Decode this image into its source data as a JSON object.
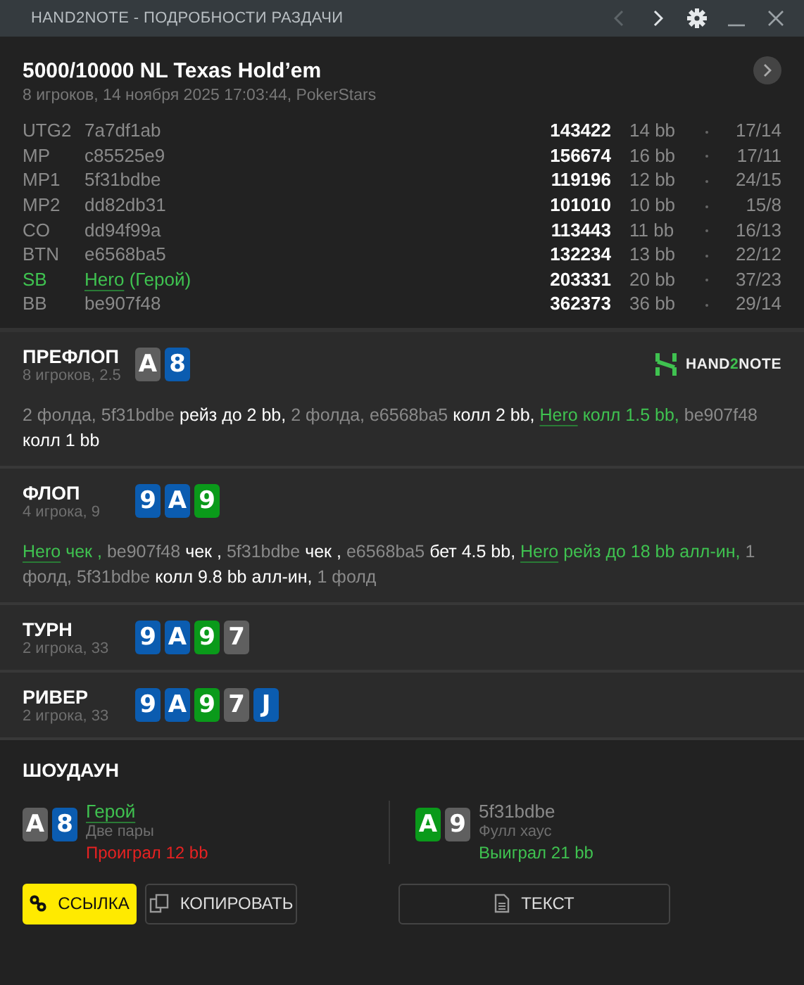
{
  "window": {
    "title": "HAND2NOTE - ПОДРОБНОСТИ РАЗДАЧИ",
    "back_enabled": false,
    "forward_enabled": true
  },
  "header": {
    "title": "5000/10000 NL Texas Hold’em",
    "subtitle": "8 игроков, 14 ноября 2025 17:03:44, PokerStars"
  },
  "players": [
    {
      "position": "UTG2",
      "name": "7a7df1ab",
      "hero": false,
      "stack": "143422",
      "bb": "14 bb",
      "stats": "17/14"
    },
    {
      "position": "MP",
      "name": "c85525e9",
      "hero": false,
      "stack": "156674",
      "bb": "16 bb",
      "stats": "17/11"
    },
    {
      "position": "MP1",
      "name": "5f31bdbe",
      "hero": false,
      "stack": "119196",
      "bb": "12 bb",
      "stats": "24/15"
    },
    {
      "position": "MP2",
      "name": "dd82db31",
      "hero": false,
      "stack": "101010",
      "bb": "10 bb",
      "stats": "15/8"
    },
    {
      "position": "CO",
      "name": "dd94f99a",
      "hero": false,
      "stack": "113443",
      "bb": "11 bb",
      "stats": "16/13"
    },
    {
      "position": "BTN",
      "name": "e6568ba5",
      "hero": false,
      "stack": "132234",
      "bb": "13 bb",
      "stats": "22/12"
    },
    {
      "position": "SB",
      "name": "Hero",
      "note": "(Герой)",
      "hero": true,
      "stack": "203331",
      "bb": "20 bb",
      "stats": "37/23"
    },
    {
      "position": "BB",
      "name": "be907f48",
      "hero": false,
      "stack": "362373",
      "bb": "36 bb",
      "stats": "29/14"
    }
  ],
  "logo": {
    "before": "HAND",
    "accent": "2",
    "after": "NOTE"
  },
  "streets": [
    {
      "name": "ПРЕФЛОП",
      "subtitle": "8 игроков, 2.5",
      "cards": [
        {
          "rank": "A",
          "color": "#5f5f5f"
        },
        {
          "rank": "8",
          "color": "#0b5cb0"
        }
      ],
      "actions": [
        {
          "kind": "plain",
          "text": "2 фолда, 5f31bdbe"
        },
        {
          "kind": "action",
          "text": "рейз до 2 bb,"
        },
        {
          "kind": "plain",
          "text": "2 фолда, e6568ba5"
        },
        {
          "kind": "action",
          "text": "колл 2 bb,"
        },
        {
          "kind": "hero",
          "text": "Hero"
        },
        {
          "kind": "hero_action",
          "text": "колл 1.5 bb,"
        },
        {
          "kind": "plain",
          "text": "be907f48"
        },
        {
          "kind": "action",
          "text": "колл 1 bb"
        }
      ]
    },
    {
      "name": "ФЛОП",
      "subtitle": "4 игрока, 9",
      "cards": [
        {
          "rank": "9",
          "color": "#0b5cb0"
        },
        {
          "rank": "A",
          "color": "#0b5cb0"
        },
        {
          "rank": "9",
          "color": "#0a9a1a"
        }
      ],
      "actions": [
        {
          "kind": "hero",
          "text": "Hero"
        },
        {
          "kind": "hero_action",
          "text": "чек ,"
        },
        {
          "kind": "plain",
          "text": "be907f48"
        },
        {
          "kind": "action",
          "text": "чек ,"
        },
        {
          "kind": "plain",
          "text": "5f31bdbe"
        },
        {
          "kind": "action",
          "text": "чек ,"
        },
        {
          "kind": "plain",
          "text": "e6568ba5"
        },
        {
          "kind": "action",
          "text": "бет 4.5 bb,"
        },
        {
          "kind": "hero",
          "text": "Hero"
        },
        {
          "kind": "hero_action",
          "text": "рейз до 18 bb алл-ин,"
        },
        {
          "kind": "plain",
          "text": "1 фолд, 5f31bdbe"
        },
        {
          "kind": "action",
          "text": "колл 9.8 bb алл-ин,"
        },
        {
          "kind": "plain",
          "text": "1 фолд"
        }
      ]
    },
    {
      "name": "ТУРН",
      "subtitle": "2 игрока, 33",
      "cards": [
        {
          "rank": "9",
          "color": "#0b5cb0"
        },
        {
          "rank": "A",
          "color": "#0b5cb0"
        },
        {
          "rank": "9",
          "color": "#0a9a1a"
        },
        {
          "rank": "7",
          "color": "#5f5f5f"
        }
      ]
    },
    {
      "name": "РИВЕР",
      "subtitle": "2 игрока, 33",
      "cards": [
        {
          "rank": "9",
          "color": "#0b5cb0"
        },
        {
          "rank": "A",
          "color": "#0b5cb0"
        },
        {
          "rank": "9",
          "color": "#0a9a1a"
        },
        {
          "rank": "7",
          "color": "#5f5f5f"
        },
        {
          "rank": "J",
          "color": "#0b5cb0"
        }
      ]
    }
  ],
  "showdown": {
    "title": "ШОУДАУН",
    "hands": [
      {
        "cards": [
          {
            "rank": "A",
            "color": "#5f5f5f"
          },
          {
            "rank": "8",
            "color": "#0b5cb0"
          }
        ],
        "name": "Герой",
        "hero": true,
        "combo": "Две пары",
        "result": "Проиграл 12 bb",
        "won": false
      },
      {
        "cards": [
          {
            "rank": "A",
            "color": "#0a9a1a"
          },
          {
            "rank": "9",
            "color": "#5f5f5f"
          }
        ],
        "name": "5f31bdbe",
        "hero": false,
        "combo": "Фулл хаус",
        "result": "Выиграл 21 bb",
        "won": true
      }
    ]
  },
  "buttons": [
    {
      "label": "ССЫЛКА",
      "primary": true
    },
    {
      "label": "КОПИРОВАТЬ",
      "primary": false
    },
    {
      "label": "ТЕКСТ",
      "primary": false
    }
  ]
}
